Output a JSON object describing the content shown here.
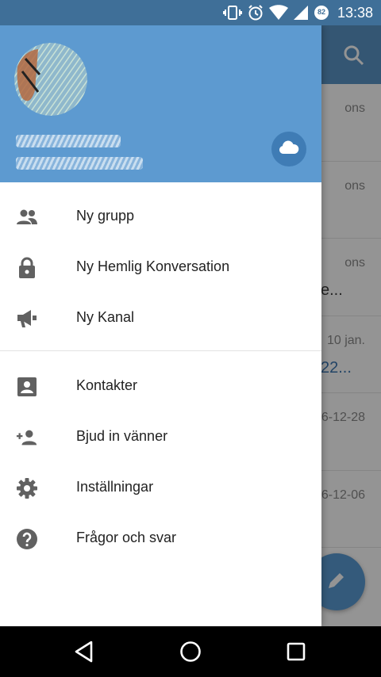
{
  "status_bar": {
    "time": "13:38",
    "icons": [
      "vibrate-icon",
      "alarm-icon",
      "wifi-icon",
      "signal-icon",
      "battery-icon"
    ],
    "battery_level": "82"
  },
  "background_chats": [
    {
      "date": "ons",
      "snippet": ""
    },
    {
      "date": "ons",
      "snippet": ""
    },
    {
      "date": "ons",
      "snippet": "e..."
    },
    {
      "date": "10 jan.",
      "snippet": "22..."
    },
    {
      "date": "6-12-28",
      "snippet": ""
    },
    {
      "date": "6-12-06",
      "snippet": ""
    }
  ],
  "drawer": {
    "menu": [
      {
        "label": "Ny grupp",
        "icon": "group-icon"
      },
      {
        "label": "Ny Hemlig Konversation",
        "icon": "lock-icon"
      },
      {
        "label": "Ny Kanal",
        "icon": "megaphone-icon"
      },
      {
        "label": "Kontakter",
        "icon": "contacts-icon"
      },
      {
        "label": "Bjud in vänner",
        "icon": "add-person-icon"
      },
      {
        "label": "Inställningar",
        "icon": "gear-icon"
      },
      {
        "label": "Frågor och svar",
        "icon": "help-icon"
      }
    ]
  },
  "colors": {
    "header": "#5d9ad0",
    "toolbar": "#5b95c6",
    "status_bar": "#3f6f98",
    "icon_gray": "#616161"
  }
}
